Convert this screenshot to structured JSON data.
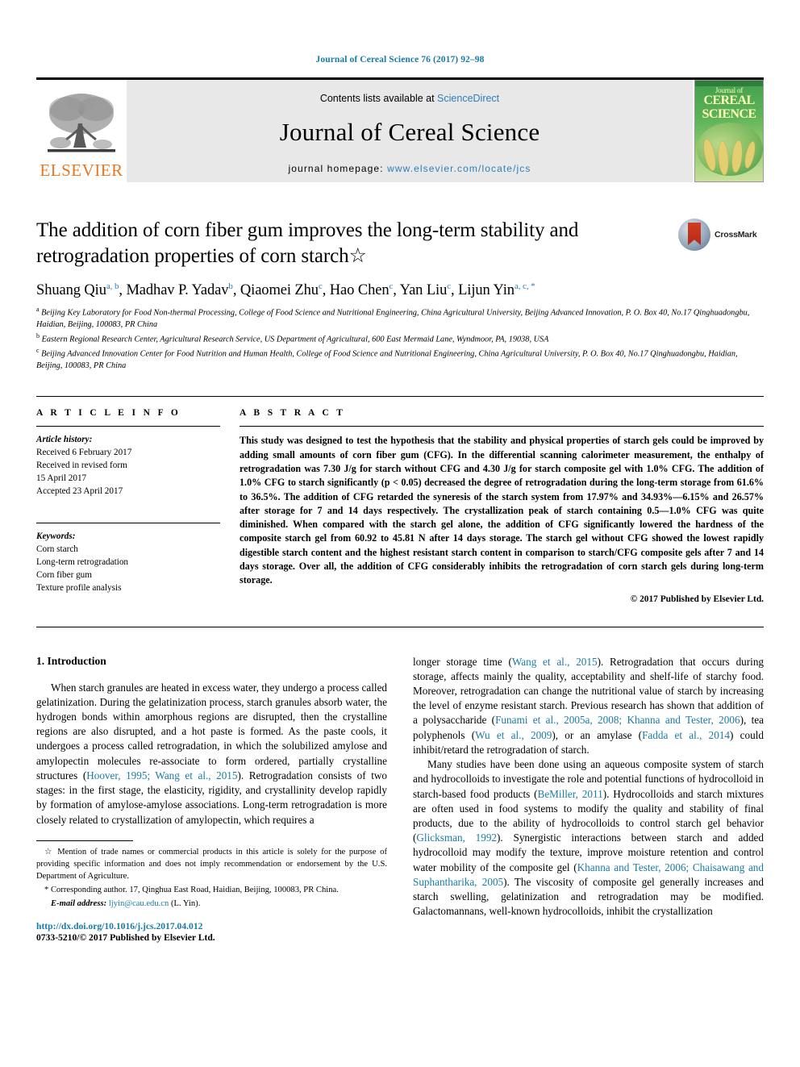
{
  "running_head": "Journal of Cereal Science 76 (2017) 92–98",
  "header": {
    "elsevier_logo_text": "ELSEVIER",
    "contents_prefix": "Contents lists available at ",
    "sciencedirect": "ScienceDirect",
    "journal_title": "Journal of Cereal Science",
    "homepage_prefix": "journal homepage: ",
    "homepage_url": "www.elsevier.com/locate/jcs",
    "cover": {
      "line1": "Journal of",
      "line2": "CEREAL",
      "line3": "SCIENCE"
    }
  },
  "title": {
    "text": "The addition of corn fiber gum improves the long-term stability and retrogradation properties of corn starch☆",
    "crossmark_label": "CrossMark"
  },
  "authors": {
    "line_parts": [
      {
        "name": "Shuang Qiu",
        "sup": "a, b"
      },
      {
        "name": "Madhav P. Yadav",
        "sup": "b"
      },
      {
        "name": "Qiaomei Zhu",
        "sup": "c"
      },
      {
        "name": "Hao Chen",
        "sup": "c"
      },
      {
        "name": "Yan Liu",
        "sup": "c"
      },
      {
        "name": "Lijun Yin",
        "sup": "a, c, *"
      }
    ],
    "affiliations": [
      {
        "marker": "a",
        "text": "Beijing Key Laboratory for Food Non-thermal Processing, College of Food Science and Nutritional Engineering, China Agricultural University, Beijing Advanced Innovation, P. O. Box 40, No.17 Qinghuadongbu, Haidian, Beijing, 100083, PR China"
      },
      {
        "marker": "b",
        "text": "Eastern Regional Research Center, Agricultural Research Service, US Department of Agricultural, 600 East Mermaid Lane, Wyndmoor, PA, 19038, USA"
      },
      {
        "marker": "c",
        "text": "Beijing Advanced Innovation Center for Food Nutrition and Human Health, College of Food Science and Nutritional Engineering, China Agricultural University, P. O. Box 40, No.17 Qinghuadongbu, Haidian, Beijing, 100083, PR China"
      }
    ]
  },
  "article_info": {
    "heading": "A R T I C L E  I N F O",
    "history_label": "Article history:",
    "history": [
      "Received 6 February 2017",
      "Received in revised form",
      "15 April 2017",
      "Accepted 23 April 2017"
    ],
    "keywords_label": "Keywords:",
    "keywords": [
      "Corn starch",
      "Long-term retrogradation",
      "Corn fiber gum",
      "Texture profile analysis"
    ]
  },
  "abstract": {
    "heading": "A B S T R A C T",
    "text": "This study was designed to test the hypothesis that the stability and physical properties of starch gels could be improved by adding small amounts of corn fiber gum (CFG). In the differential scanning calorimeter measurement, the enthalpy of retrogradation was 7.30 J/g for starch without CFG and 4.30 J/g for starch composite gel with 1.0% CFG. The addition of 1.0% CFG to starch significantly (p < 0.05) decreased the degree of retrogradation during the long-term storage from 61.6% to 36.5%. The addition of CFG retarded the syneresis of the starch system from 17.97% and 34.93%—6.15% and 26.57% after storage for 7 and 14 days respectively. The crystallization peak of starch containing 0.5—1.0% CFG was quite diminished. When compared with the starch gel alone, the addition of CFG significantly lowered the hardness of the composite starch gel from 60.92 to 45.81 N after 14 days storage. The starch gel without CFG showed the lowest rapidly digestible starch content and the highest resistant starch content in comparison to starch/CFG composite gels after 7 and 14 days storage. Over all, the addition of CFG considerably inhibits the retrogradation of corn starch gels during long-term storage.",
    "copyright": "© 2017 Published by Elsevier Ltd."
  },
  "introduction": {
    "heading": "1. Introduction",
    "left_paragraphs": [
      {
        "segments": [
          {
            "t": "When starch granules are heated in excess water, they undergo a process called gelatinization. During the gelatinization process, starch granules absorb water, the hydrogen bonds within amorphous regions are disrupted, then the crystalline regions are also disrupted, and a hot paste is formed. As the paste cools, it undergoes a process called retrogradation, in which the solubilized amylose and amylopectin molecules re-associate to form ordered, partially crystalline structures (",
            "ref": false
          },
          {
            "t": "Hoover, 1995; Wang et al., 2015",
            "ref": true
          },
          {
            "t": "). Retrogradation consists of two stages: in the first stage, the elasticity, rigidity, and crystallinity develop rapidly by formation of amylose-amylose associations. Long-term retrogradation is more closely related to crystallization of amylopectin, which requires a",
            "ref": false
          }
        ]
      }
    ],
    "right_paragraphs": [
      {
        "segments": [
          {
            "t": "longer storage time (",
            "ref": false
          },
          {
            "t": "Wang et al., 2015",
            "ref": true
          },
          {
            "t": "). Retrogradation that occurs during storage, affects mainly the quality, acceptability and shelf-life of starchy food. Moreover, retrogradation can change the nutritional value of starch by increasing the level of enzyme resistant starch. Previous research has shown that addition of a polysaccharide (",
            "ref": false
          },
          {
            "t": "Funami et al., 2005a, 2008; Khanna and Tester, 2006",
            "ref": true
          },
          {
            "t": "), tea polyphenols (",
            "ref": false
          },
          {
            "t": "Wu et al., 2009",
            "ref": true
          },
          {
            "t": "), or an amylase (",
            "ref": false
          },
          {
            "t": "Fadda et al., 2014",
            "ref": true
          },
          {
            "t": ") could inhibit/retard the retrogradation of starch.",
            "ref": false
          }
        ],
        "indent": false
      },
      {
        "segments": [
          {
            "t": "Many studies have been done using an aqueous composite system of starch and hydrocolloids to investigate the role and potential functions of hydrocolloid in starch-based food products (",
            "ref": false
          },
          {
            "t": "BeMiller, 2011",
            "ref": true
          },
          {
            "t": "). Hydrocolloids and starch mixtures are often used in food systems to modify the quality and stability of final products, due to the ability of hydrocolloids to control starch gel behavior (",
            "ref": false
          },
          {
            "t": "Glicksman, 1992",
            "ref": true
          },
          {
            "t": "). Synergistic interactions between starch and added hydrocolloid may modify the texture, improve moisture retention and control water mobility of the composite gel (",
            "ref": false
          },
          {
            "t": "Khanna and Tester, 2006; Chaisawang and Suphantharika, 2005",
            "ref": true
          },
          {
            "t": "). The viscosity of composite gel generally increases and starch swelling, gelatinization and retrogradation may be modified. Galactomannans, well-known hydrocolloids, inhibit the crystallization",
            "ref": false
          }
        ],
        "indent": true
      }
    ]
  },
  "footnotes": {
    "star_note": "☆ Mention of trade names or commercial products in this article is solely for the purpose of providing specific information and does not imply recommendation or endorsement by the U.S. Department of Agriculture.",
    "corresponding": "* Corresponding author. 17, Qinghua East Road, Haidian, Beijing, 100083, PR China.",
    "email_label": "E-mail address:",
    "email": "ljyin@cau.edu.cn",
    "email_suffix": "(L. Yin)."
  },
  "footer": {
    "doi": "http://dx.doi.org/10.1016/j.jcs.2017.04.012",
    "issn_line": "0733-5210/© 2017 Published by Elsevier Ltd."
  },
  "colors": {
    "link": "#1a7ba8",
    "sciencedirect": "#2e7eb8",
    "elsevier_orange": "#e87722",
    "band_gray": "#e8e8e8"
  }
}
